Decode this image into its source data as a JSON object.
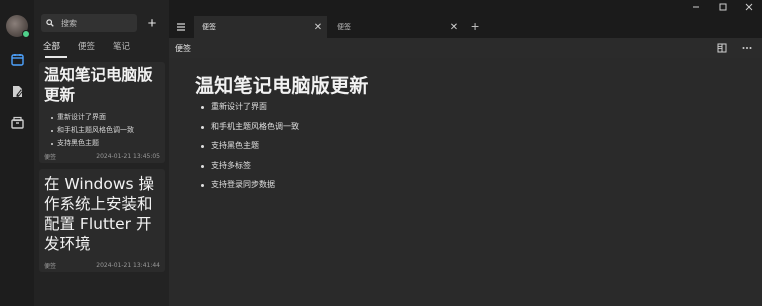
{
  "search": {
    "placeholder": "搜索"
  },
  "list": {
    "add_label": "+",
    "filters": [
      "全部",
      "便签",
      "笔记"
    ],
    "notes": [
      {
        "title": "温知笔记电脑版更新",
        "items": [
          "重新设计了界面",
          "和手机主题风格色调一致",
          "支持黑色主题"
        ],
        "category": "便签",
        "timestamp": "2024-01-21 13:45:05"
      },
      {
        "title": "在 Windows 操作系统上安装和配置 Flutter 开发环境",
        "items": [],
        "category": "便签",
        "timestamp": "2024-01-21 13:41:44"
      }
    ]
  },
  "tabs": [
    {
      "label": "便签",
      "close": "✕"
    },
    {
      "label": "便签",
      "close": "✕"
    }
  ],
  "tab_add_label": "+",
  "toolbar": {
    "label": "便签"
  },
  "document": {
    "title": "温知笔记电脑版更新",
    "items": [
      "重新设计了界面",
      "和手机主题风格色调一致",
      "支持黑色主题",
      "支持多标签",
      "支持登录同步数据"
    ]
  },
  "colors": {
    "background": "#1b1b1b",
    "panel": "#2b2b2b",
    "sidebar": "#232323",
    "accent_active": "#4ea3ff",
    "status_online": "#4fd18b"
  },
  "icons": {
    "rail": [
      "calendar-icon",
      "edit-note-icon",
      "archive-icon"
    ],
    "toolbar": [
      "split-view-icon",
      "more-icon"
    ],
    "window": [
      "minimize-icon",
      "maximize-icon",
      "close-icon"
    ]
  }
}
